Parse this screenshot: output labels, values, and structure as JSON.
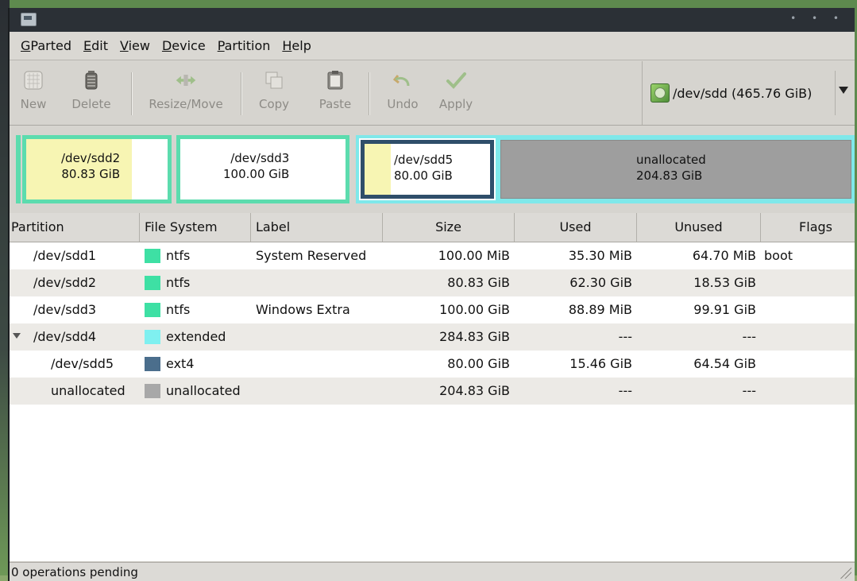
{
  "menubar": [
    {
      "u": "G",
      "rest": "Parted"
    },
    {
      "u": "E",
      "rest": "dit"
    },
    {
      "u": "V",
      "rest": "iew"
    },
    {
      "u": "D",
      "rest": "evice"
    },
    {
      "u": "P",
      "rest": "artition"
    },
    {
      "u": "H",
      "rest": "elp"
    }
  ],
  "toolbar": {
    "new": "New",
    "delete": "Delete",
    "resize_move": "Resize/Move",
    "copy": "Copy",
    "paste": "Paste",
    "undo": "Undo",
    "apply": "Apply"
  },
  "device": {
    "label": "/dev/sdd  (465.76 GiB)"
  },
  "partition_map": [
    {
      "name": "/dev/sdd2",
      "size": "80.83 GiB"
    },
    {
      "name": "/dev/sdd3",
      "size": "100.00 GiB"
    },
    {
      "name": "/dev/sdd5",
      "size": "80.00 GiB"
    },
    {
      "name": "unallocated",
      "size": "204.83 GiB"
    }
  ],
  "columns": [
    "Partition",
    "File System",
    "Label",
    "Size",
    "Used",
    "Unused",
    "Flags"
  ],
  "rows": [
    {
      "partition": "/dev/sdd1",
      "fs": "ntfs",
      "fs_color": "#3ee0a4",
      "label": "System Reserved",
      "size": "100.00 MiB",
      "used": "35.30 MiB",
      "unused": "64.70 MiB",
      "flags": "boot"
    },
    {
      "partition": "/dev/sdd2",
      "fs": "ntfs",
      "fs_color": "#3ee0a4",
      "label": "",
      "size": "80.83 GiB",
      "used": "62.30 GiB",
      "unused": "18.53 GiB",
      "flags": ""
    },
    {
      "partition": "/dev/sdd3",
      "fs": "ntfs",
      "fs_color": "#3ee0a4",
      "label": "Windows Extra",
      "size": "100.00 GiB",
      "used": "88.89 MiB",
      "unused": "99.91 GiB",
      "flags": ""
    },
    {
      "partition": "/dev/sdd4",
      "fs": "extended",
      "fs_color": "#7ff0f0",
      "label": "",
      "size": "284.83 GiB",
      "used": "---",
      "unused": "---",
      "flags": ""
    },
    {
      "partition": "/dev/sdd5",
      "fs": "ext4",
      "fs_color": "#4b6e8c",
      "label": "",
      "size": "80.00 GiB",
      "used": "15.46 GiB",
      "unused": "64.54 GiB",
      "flags": ""
    },
    {
      "partition": "unallocated",
      "fs": "unallocated",
      "fs_color": "#a8a8a8",
      "label": "",
      "size": "204.83 GiB",
      "used": "---",
      "unused": "---",
      "flags": ""
    }
  ],
  "status": {
    "text": "0 operations pending"
  }
}
